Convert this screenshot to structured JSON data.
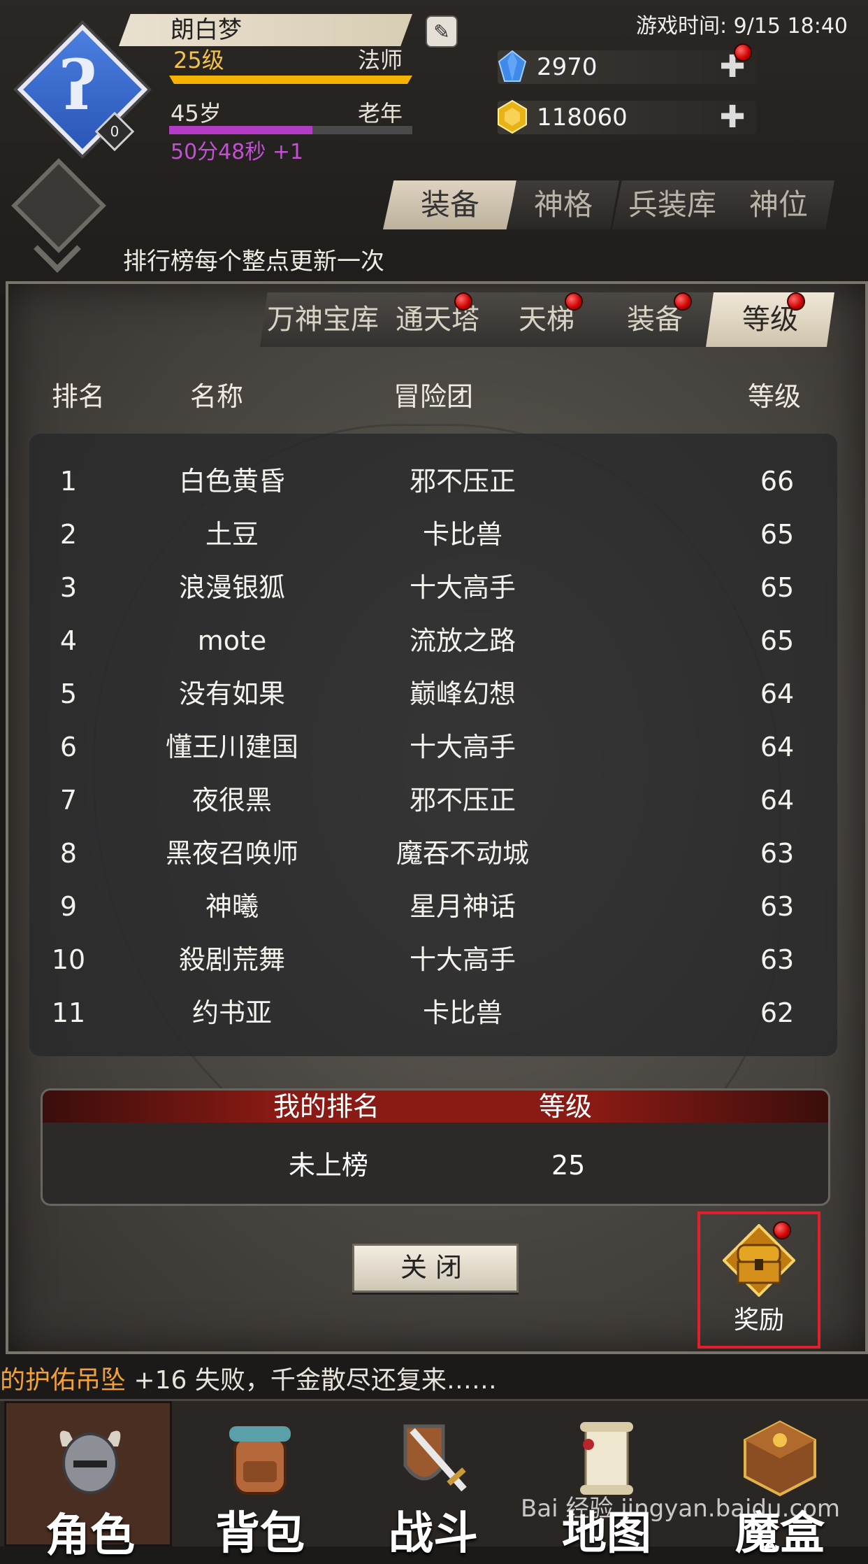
{
  "header": {
    "player_name": "朗白梦",
    "avatar_badge": "0",
    "level": "25级",
    "class": "法师",
    "age": "45岁",
    "age_stage": "老年",
    "age_progress": 0.59,
    "timer": "50分48秒 +1",
    "game_time": "游戏时间: 9/15 18:40",
    "diamonds": "2970",
    "gold": "118060",
    "notice": "排行榜每个整点更新一次"
  },
  "top_tabs": [
    "装备",
    "神格",
    "兵装库",
    "神位"
  ],
  "sub_tabs": [
    "万神宝库",
    "通天塔",
    "天梯",
    "装备",
    "等级"
  ],
  "table": {
    "headers": [
      "排名",
      "名称",
      "冒险团",
      "等级"
    ],
    "rows": [
      {
        "rank": "1",
        "name": "白色黄昏",
        "guild": "邪不压正",
        "level": "66"
      },
      {
        "rank": "2",
        "name": "土豆",
        "guild": "卡比兽",
        "level": "65"
      },
      {
        "rank": "3",
        "name": "浪漫银狐",
        "guild": "十大高手",
        "level": "65"
      },
      {
        "rank": "4",
        "name": "mote",
        "guild": "流放之路",
        "level": "65"
      },
      {
        "rank": "5",
        "name": "没有如果",
        "guild": "巅峰幻想",
        "level": "64"
      },
      {
        "rank": "6",
        "name": "懂王川建国",
        "guild": "十大高手",
        "level": "64"
      },
      {
        "rank": "7",
        "name": "夜很黑",
        "guild": "邪不压正",
        "level": "64"
      },
      {
        "rank": "8",
        "name": "黑夜召唤师",
        "guild": "魔吞不动城",
        "level": "63"
      },
      {
        "rank": "9",
        "name": "神曦",
        "guild": "星月神话",
        "level": "63"
      },
      {
        "rank": "10",
        "name": "殺剧荒舞",
        "guild": "十大高手",
        "level": "63"
      },
      {
        "rank": "11",
        "name": "约书亚",
        "guild": "卡比兽",
        "level": "62"
      }
    ]
  },
  "my_rank": {
    "rank_label": "我的排名",
    "level_label": "等级",
    "rank_value": "未上榜",
    "level_value": "25"
  },
  "close_label": "关闭",
  "reward_label": "奖励",
  "log": {
    "item": "的护佑吊坠",
    "rest": " +16 失败，千金散尽还复来……"
  },
  "bottom_nav": [
    "角色",
    "背包",
    "战斗",
    "地图",
    "魔盒"
  ],
  "watermark": "Bai 经验 jingyan.baidu.com",
  "colors": {
    "level_bar": "#f5b300",
    "age_bar": "#b23cc4",
    "log_item": "#f0a13a",
    "reward_highlight": "#e0202a"
  },
  "icons": {
    "avatar": "mage-staff-icon",
    "diamond": "blue-gem-icon",
    "gold": "gold-coin-icon",
    "reward": "treasure-chest-icon"
  }
}
